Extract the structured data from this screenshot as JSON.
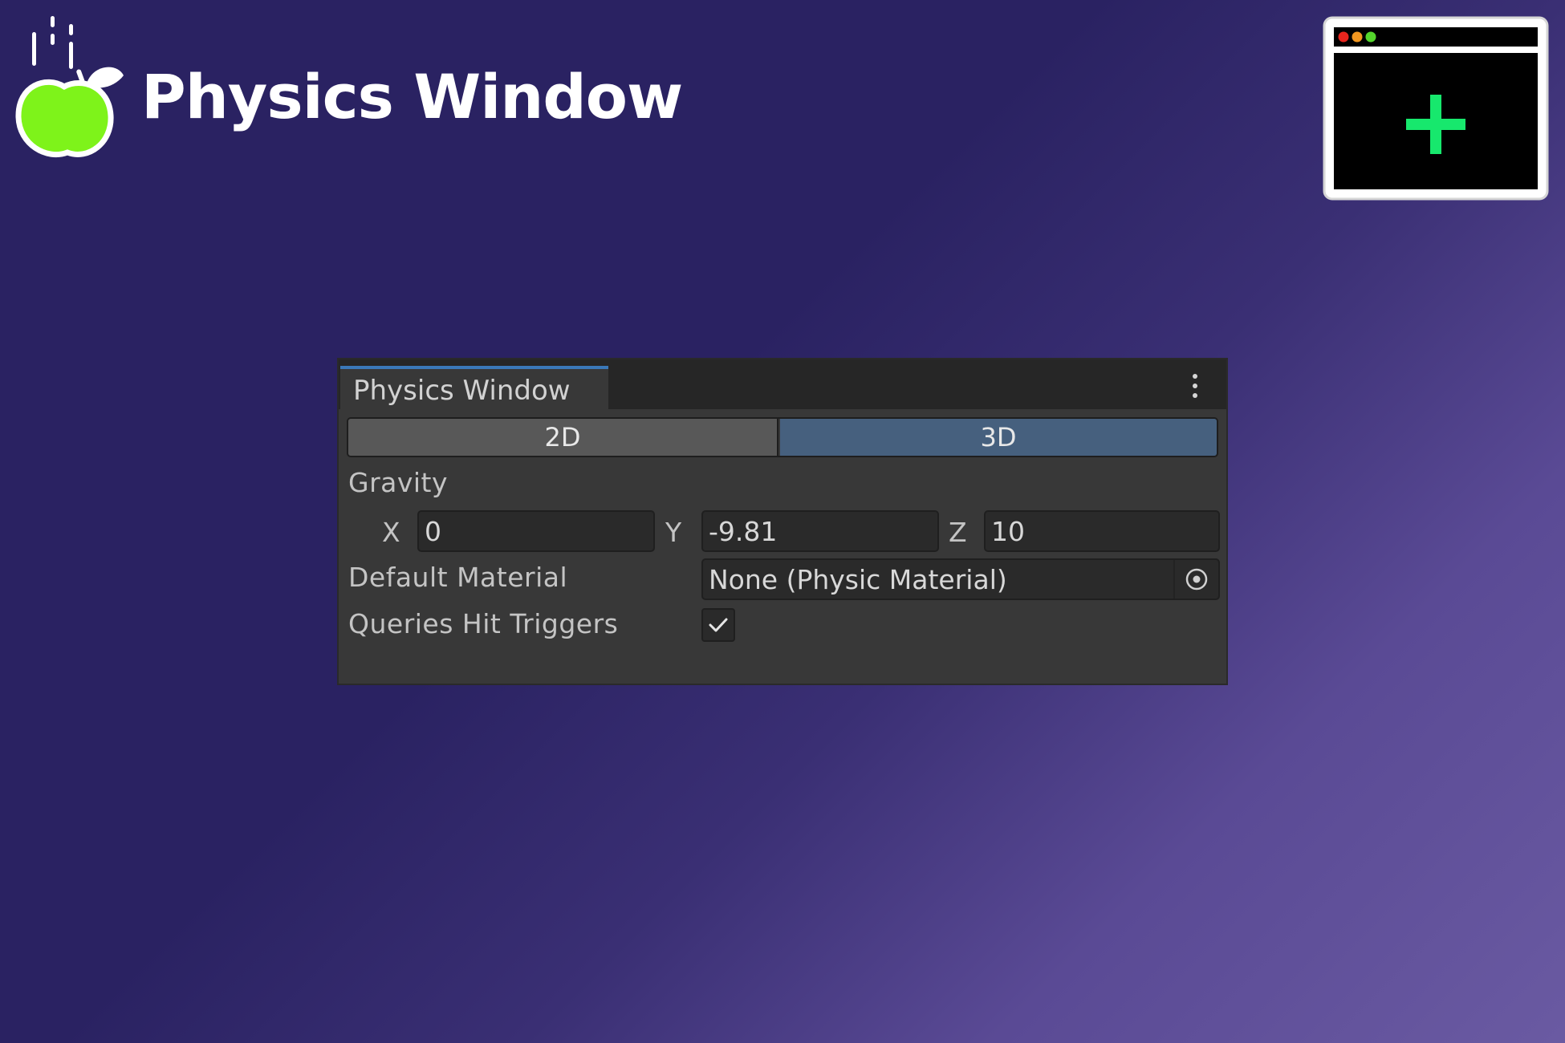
{
  "header": {
    "title": "Physics Window",
    "logo_icon": "falling-apple-icon",
    "badge_icon": "new-window-plus-icon"
  },
  "colors": {
    "apple_green": "#7ef31a",
    "plus_green": "#17e86d",
    "tab_accent": "#3a78b8",
    "segment_selected": "#46607e"
  },
  "panel": {
    "tab_label": "Physics Window",
    "menu_icon": "kebab-menu-icon",
    "modes": [
      {
        "label": "2D",
        "selected": false
      },
      {
        "label": "3D",
        "selected": true
      }
    ],
    "gravity": {
      "label": "Gravity",
      "x_label": "X",
      "x_value": "0",
      "y_label": "Y",
      "y_value": "-9.81",
      "z_label": "Z",
      "z_value": "10"
    },
    "default_material": {
      "label": "Default Material",
      "value": "None (Physic Material)",
      "picker_icon": "object-picker-icon"
    },
    "queries_hit_triggers": {
      "label": "Queries Hit Triggers",
      "checked": true
    }
  }
}
